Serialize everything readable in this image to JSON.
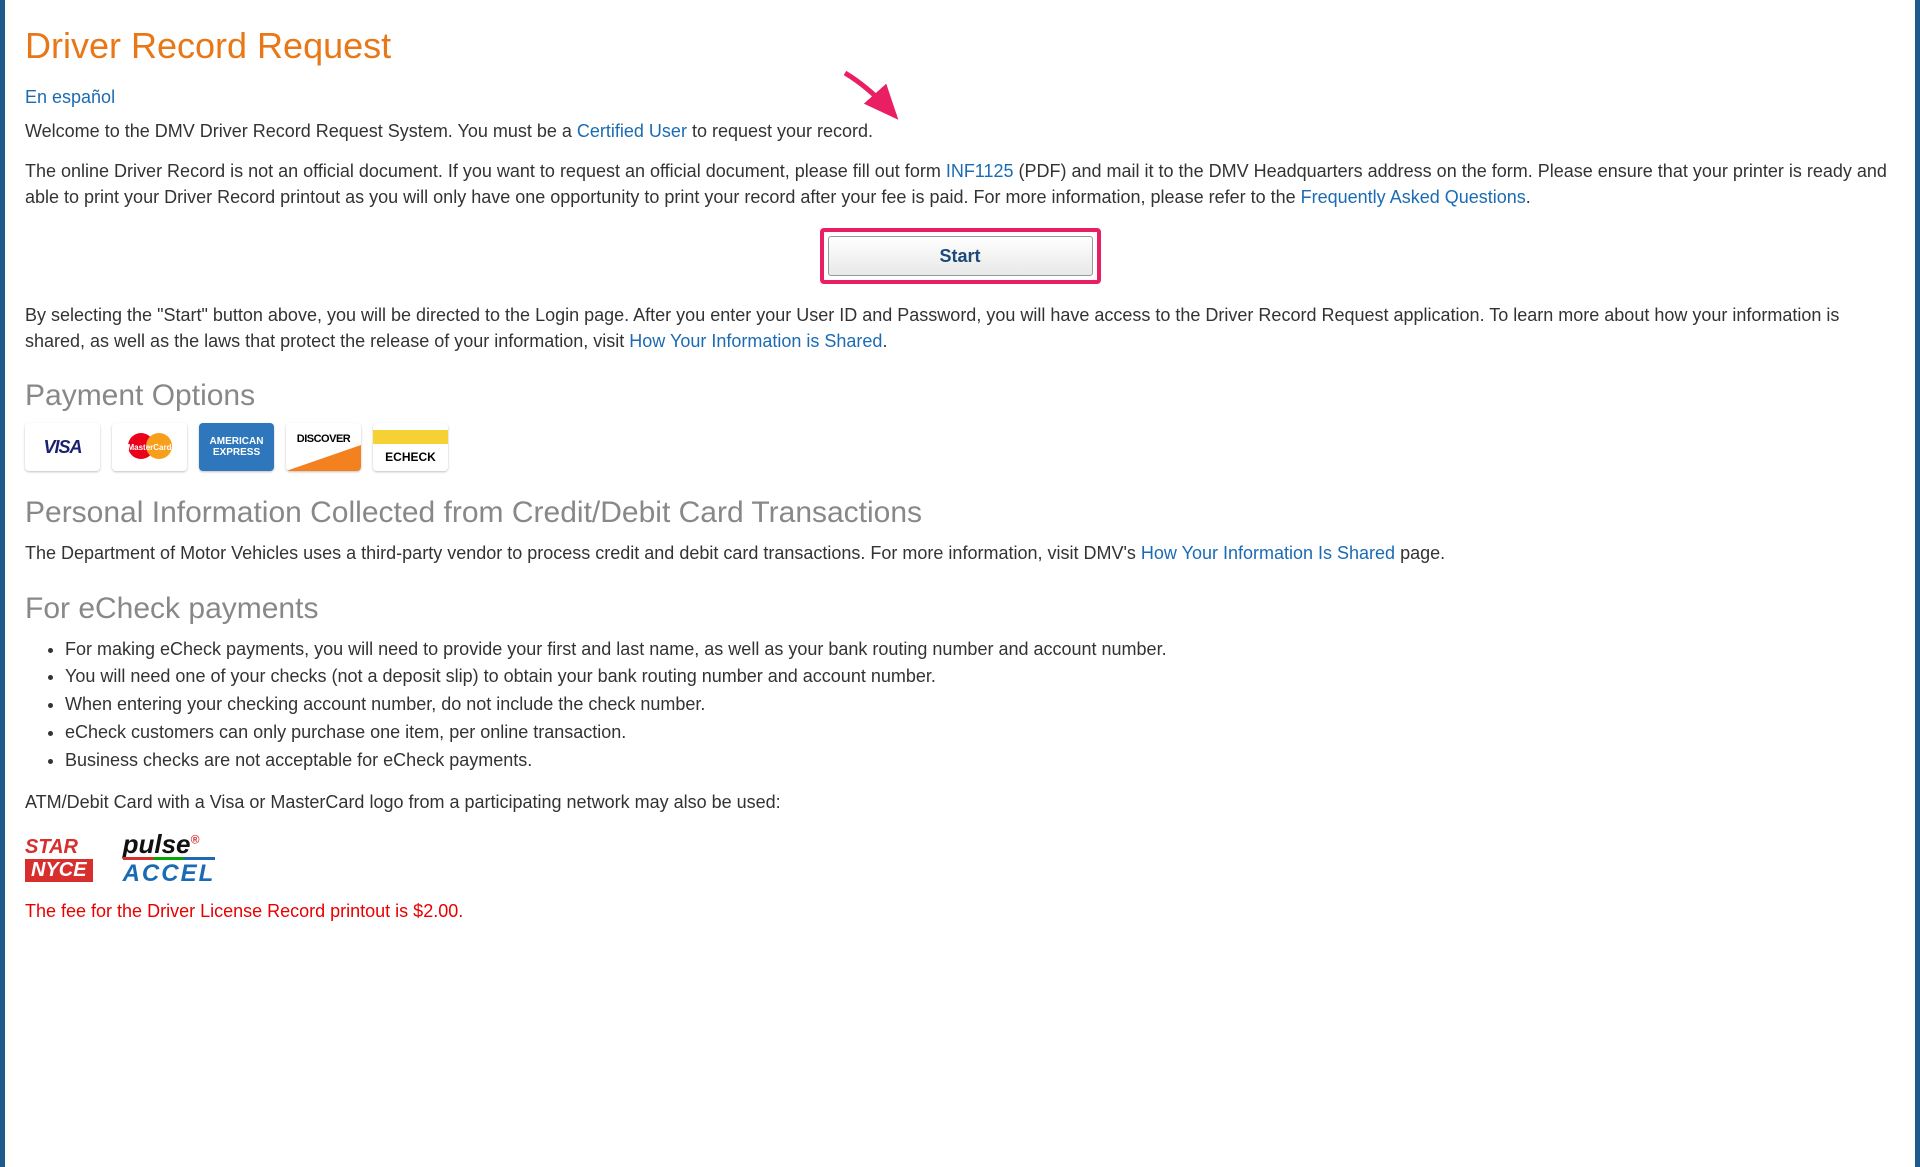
{
  "title": "Driver Record Request",
  "lang_link": "En español",
  "intro": {
    "pre": "Welcome to the DMV Driver Record Request System. You must be a ",
    "link": "Certified User",
    "post": " to request your record."
  },
  "para2": {
    "a": "The online Driver Record is not an official document. If you want to request an official document, please fill out form ",
    "form_link": "INF1125",
    "b": " (PDF) and mail it to the DMV Headquarters address on the form. Please ensure that your printer is ready and able to print your Driver Record printout as you will only have one opportunity to print your record after your fee is paid. For more information, please refer to the ",
    "faq_link": "Frequently Asked Questions",
    "c": "."
  },
  "start_label": "Start",
  "para3": {
    "a": "By selecting the \"Start\" button above, you will be directed to the Login page. After you enter your User ID and Password, you will have access to the Driver Record Request application. To learn more about how your information is shared, as well as the laws that protect the release of your information, visit ",
    "link": "How Your Information is Shared",
    "b": "."
  },
  "payment_heading": "Payment Options",
  "cards": {
    "visa": "VISA",
    "mc": "MasterCard",
    "amex": "AMERICAN EXPRESS",
    "discover": "DISCOVER",
    "echeck": "ECHECK"
  },
  "pii_heading": "Personal Information Collected from Credit/Debit Card Transactions",
  "pii_para": {
    "a": "The Department of Motor Vehicles uses a third-party vendor to process credit and debit card transactions. For more information, visit DMV's ",
    "link": "How Your Information Is Shared",
    "b": " page."
  },
  "echeck_heading": "For eCheck payments",
  "echeck_items": [
    "For making eCheck payments, you will need to provide your first and last name, as well as your bank routing number and account number.",
    "You will need one of your checks (not a deposit slip) to obtain your bank routing number and account number.",
    "When entering your checking account number, do not include the check number.",
    "eCheck customers can only purchase one item, per online transaction.",
    "Business checks are not acceptable for eCheck payments."
  ],
  "atm_note": "ATM/Debit Card with a Visa or MasterCard logo from a participating network may also be used:",
  "networks": {
    "star": "STAR",
    "nyce": "NYCE",
    "pulse": "pulse",
    "accel": "ACCEL"
  },
  "fee": "The fee for the Driver License Record printout is $2.00."
}
